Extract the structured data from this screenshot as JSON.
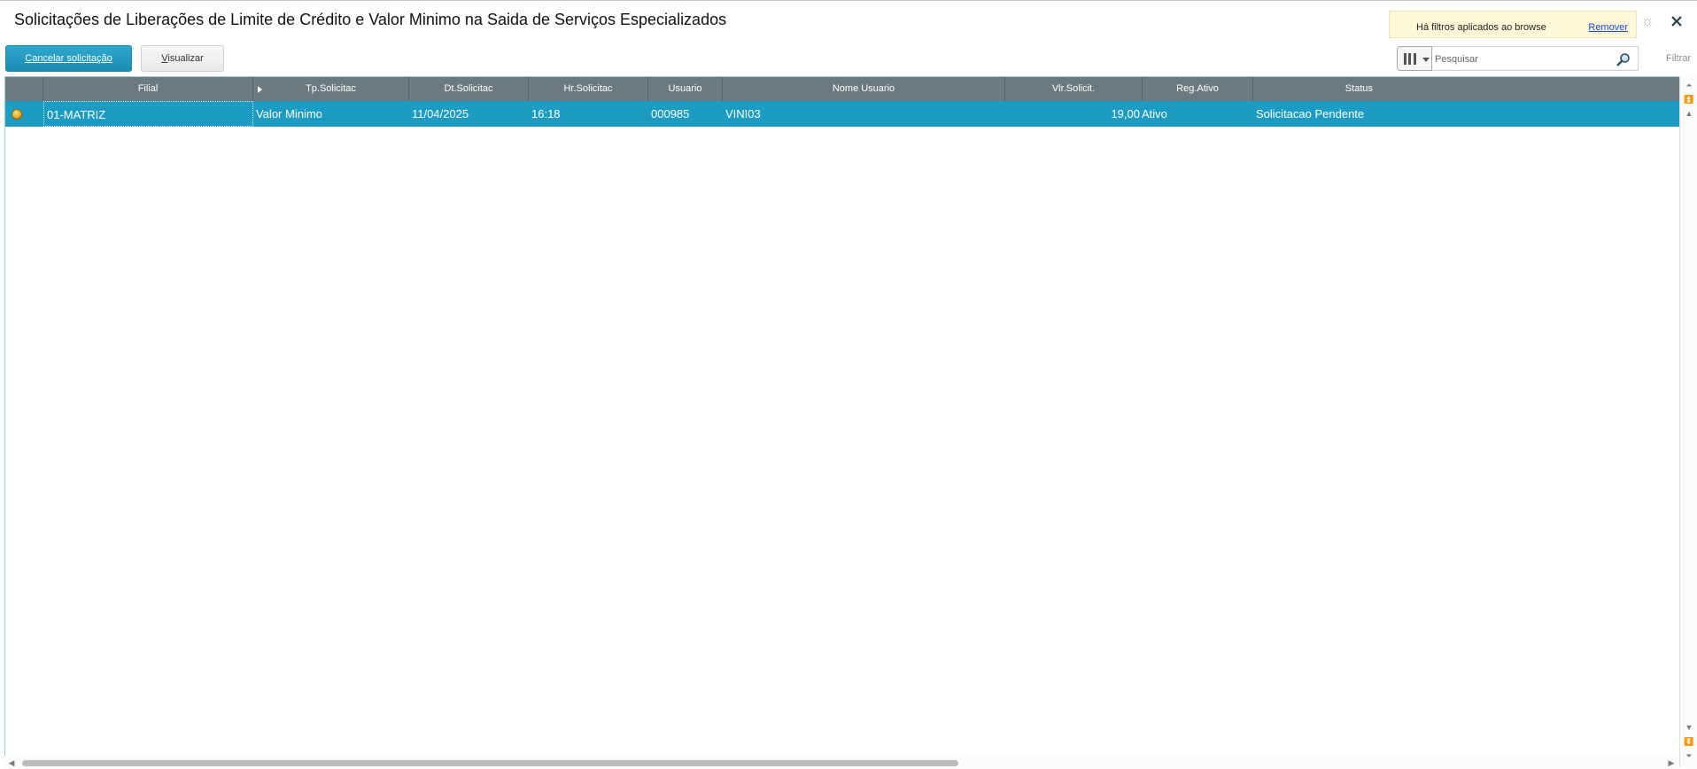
{
  "window": {
    "title": "Solicitações de Liberações de Limite de Crédito e Valor Minimo na Saida de Serviços Especializados"
  },
  "filter_notice": {
    "message": "Há filtros aplicados ao browse",
    "remove_label": "Remover"
  },
  "toolbar": {
    "cancel_label": "Cancelar solicitação",
    "view_prefix": "V",
    "view_rest": "isualizar"
  },
  "search": {
    "placeholder": "Pesquisar",
    "filter_label": "Filtrar"
  },
  "grid": {
    "columns": [
      "",
      "Filial",
      "Tp.Solicitac",
      "Dt.Solicitac",
      "Hr.Solicitac",
      "Usuario",
      "Nome Usuario",
      "Vlr.Solicit.",
      "Reg.Ativo",
      "Status"
    ],
    "rows": [
      {
        "legend_color": "#e59a0f",
        "filial": "01-MATRIZ",
        "tp_solicitac": "Valor Minimo",
        "dt_solicitac": "11/04/2025",
        "hr_solicitac": "16:18",
        "usuario": "000985",
        "nome_usuario": "VINI03",
        "vlr_solicit": "19,00",
        "reg_ativo": "Ativo",
        "status": "Solicitacao Pendente"
      }
    ]
  },
  "colors": {
    "header_bg": "#6c7a80",
    "selected_row": "#1c9bc3",
    "primary_button": "#1c8db3",
    "notice_bg": "#fdf9d8"
  }
}
